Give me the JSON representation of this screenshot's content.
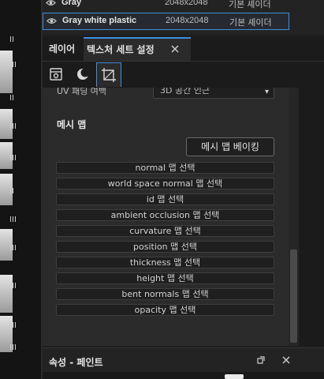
{
  "texture_sets": [
    {
      "name": "Gray",
      "resolution": "2048x2048",
      "shader": "기본 셰이더",
      "selected": false
    },
    {
      "name": "Gray white plastic",
      "resolution": "2048x2048",
      "shader": "기본 셰이더",
      "selected": true
    }
  ],
  "tabs": {
    "layers": "레이어",
    "texture_set_settings": "텍스처 세트 설정",
    "active": "texture_set_settings"
  },
  "icon_tools": [
    "settings-panel-icon",
    "moon-mesh-icon",
    "uv-crop-icon"
  ],
  "panel": {
    "uv_label": "UV 패딩 여백",
    "uv_value": "3D 공간 인근",
    "mesh_maps_title": "메시 맵",
    "bake_button": "메시 맵 베이킹",
    "map_buttons": [
      "normal 맵 선택",
      "world space normal 맵 선택",
      "id 맵 선택",
      "ambient occlusion 맵 선택",
      "curvature 맵 선택",
      "position 맵 선택",
      "thickness 맵 선택",
      "height 맵 선택",
      "bent normals 맵 선택",
      "opacity 맵 선택"
    ]
  },
  "properties": {
    "title": "속성 - 페인트"
  },
  "colors": {
    "accent": "#3d8ee0",
    "panel": "#2b2b2b",
    "background": "#1e1e1e"
  }
}
